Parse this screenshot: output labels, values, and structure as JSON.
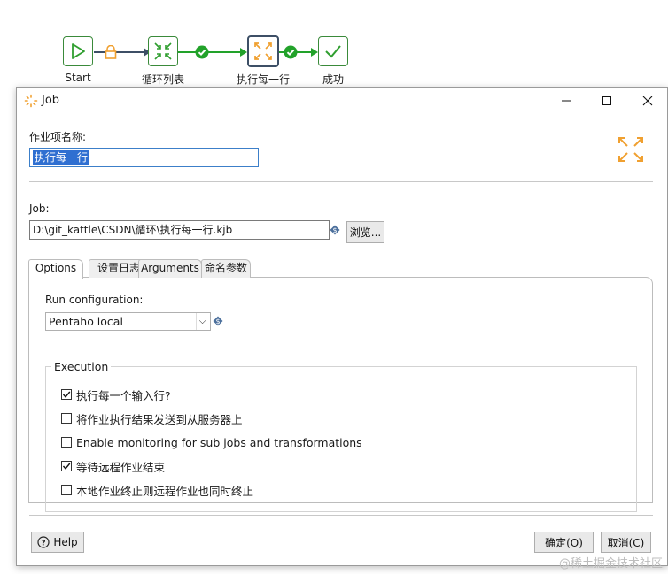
{
  "workflow": {
    "nodes": [
      {
        "label": "Start",
        "icon": "play-icon"
      },
      {
        "label": "循环列表",
        "icon": "shrink-arrows-icon"
      },
      {
        "label": "执行每一行",
        "icon": "expand-arrows-icon"
      },
      {
        "label": "成功",
        "icon": "checkmark-icon"
      }
    ]
  },
  "window": {
    "title": "Job",
    "job_entry_name_label": "作业项名称:",
    "job_entry_name_value": "执行每一行",
    "job_label": "Job:",
    "job_path": "D:\\git_kattle\\CSDN\\循环\\执行每一行.kjb",
    "browse_button": "浏览...",
    "tabs": [
      "Options",
      "设置日志",
      "Arguments",
      "命名参数"
    ],
    "run_config_label": "Run configuration:",
    "run_config_value": "Pentaho local",
    "execution_group_title": "Execution",
    "checkboxes": [
      {
        "label": "执行每一个输入行?",
        "checked": true
      },
      {
        "label": "将作业执行结果发送到从服务器上",
        "checked": false
      },
      {
        "label": "Enable monitoring for sub jobs and transformations",
        "checked": false
      },
      {
        "label": "等待远程作业结束",
        "checked": true
      },
      {
        "label": "本地作业终止则远程作业也同时终止",
        "checked": false
      }
    ],
    "help_button": "Help",
    "ok_button": "确定(O)",
    "cancel_button": "取消(C)"
  },
  "watermark": "@稀土掘金技术社区",
  "colors": {
    "node_green": "#3a8a3a",
    "accent_orange": "#f0a030",
    "selection_blue": "#2f6fd1"
  }
}
